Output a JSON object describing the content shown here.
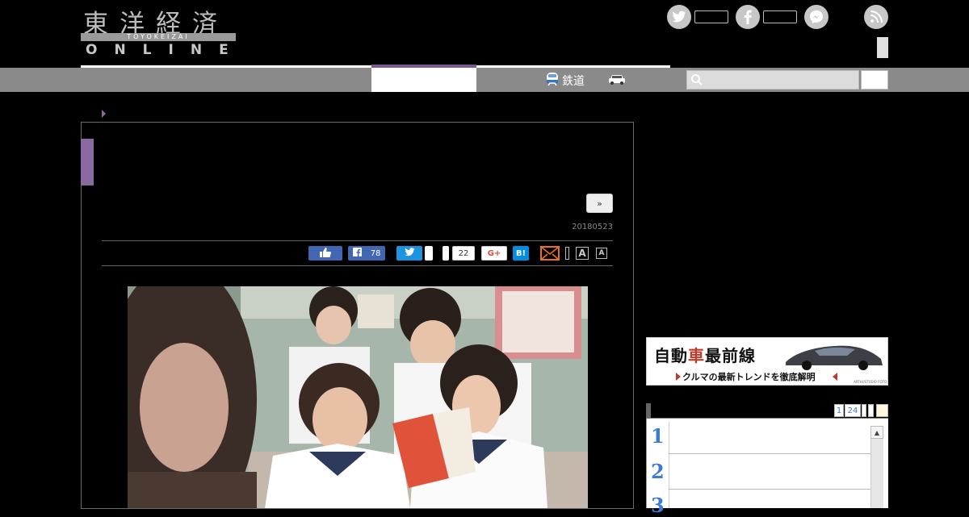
{
  "logo": {
    "kanji": "東洋経済",
    "romaji": "TOYOKEIZAI",
    "online": "ONLINE"
  },
  "social_icons": [
    "twitter-icon",
    "facebook-icon",
    "messenger-icon",
    "rss-icon"
  ],
  "nav": {
    "rail_label": "鉄道",
    "rail_icon": "train-icon",
    "car_icon": "car-icon"
  },
  "search": {
    "placeholder": ""
  },
  "article": {
    "next_label": "»",
    "date": "20180523"
  },
  "share": {
    "facebook_count": "78",
    "hatena_label": "B!",
    "google_label": "G+",
    "pocket_count": "22"
  },
  "font_size": {
    "large": "A",
    "small": "A"
  },
  "sidebar": {
    "banner": {
      "title_a": "自動",
      "title_b": "車",
      "title_c": "最前線",
      "subtitle": "クルマの最新トレンドを徹底解明",
      "credit": "ARTHUSTUDIO FOTO"
    },
    "ranking": {
      "tabs": [
        "1",
        "24"
      ],
      "numbers": [
        "1",
        "2",
        "3"
      ]
    }
  },
  "colors": {
    "accent": "#8a6aa0",
    "navbar": "#8a8a8a",
    "rank_number": "#3b7bd6"
  }
}
